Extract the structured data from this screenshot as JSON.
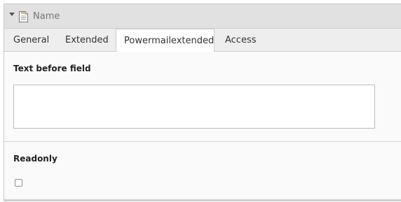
{
  "record": {
    "title": "Name",
    "icon": "document-icon"
  },
  "tabs": [
    {
      "label": "General",
      "active": false
    },
    {
      "label": "Extended",
      "active": false
    },
    {
      "label": "Powermailextended",
      "active": true
    },
    {
      "label": "Access",
      "active": false
    }
  ],
  "fields": {
    "text_before_field": {
      "label": "Text before field",
      "value": ""
    },
    "readonly": {
      "label": "Readonly",
      "checked": false
    }
  }
}
